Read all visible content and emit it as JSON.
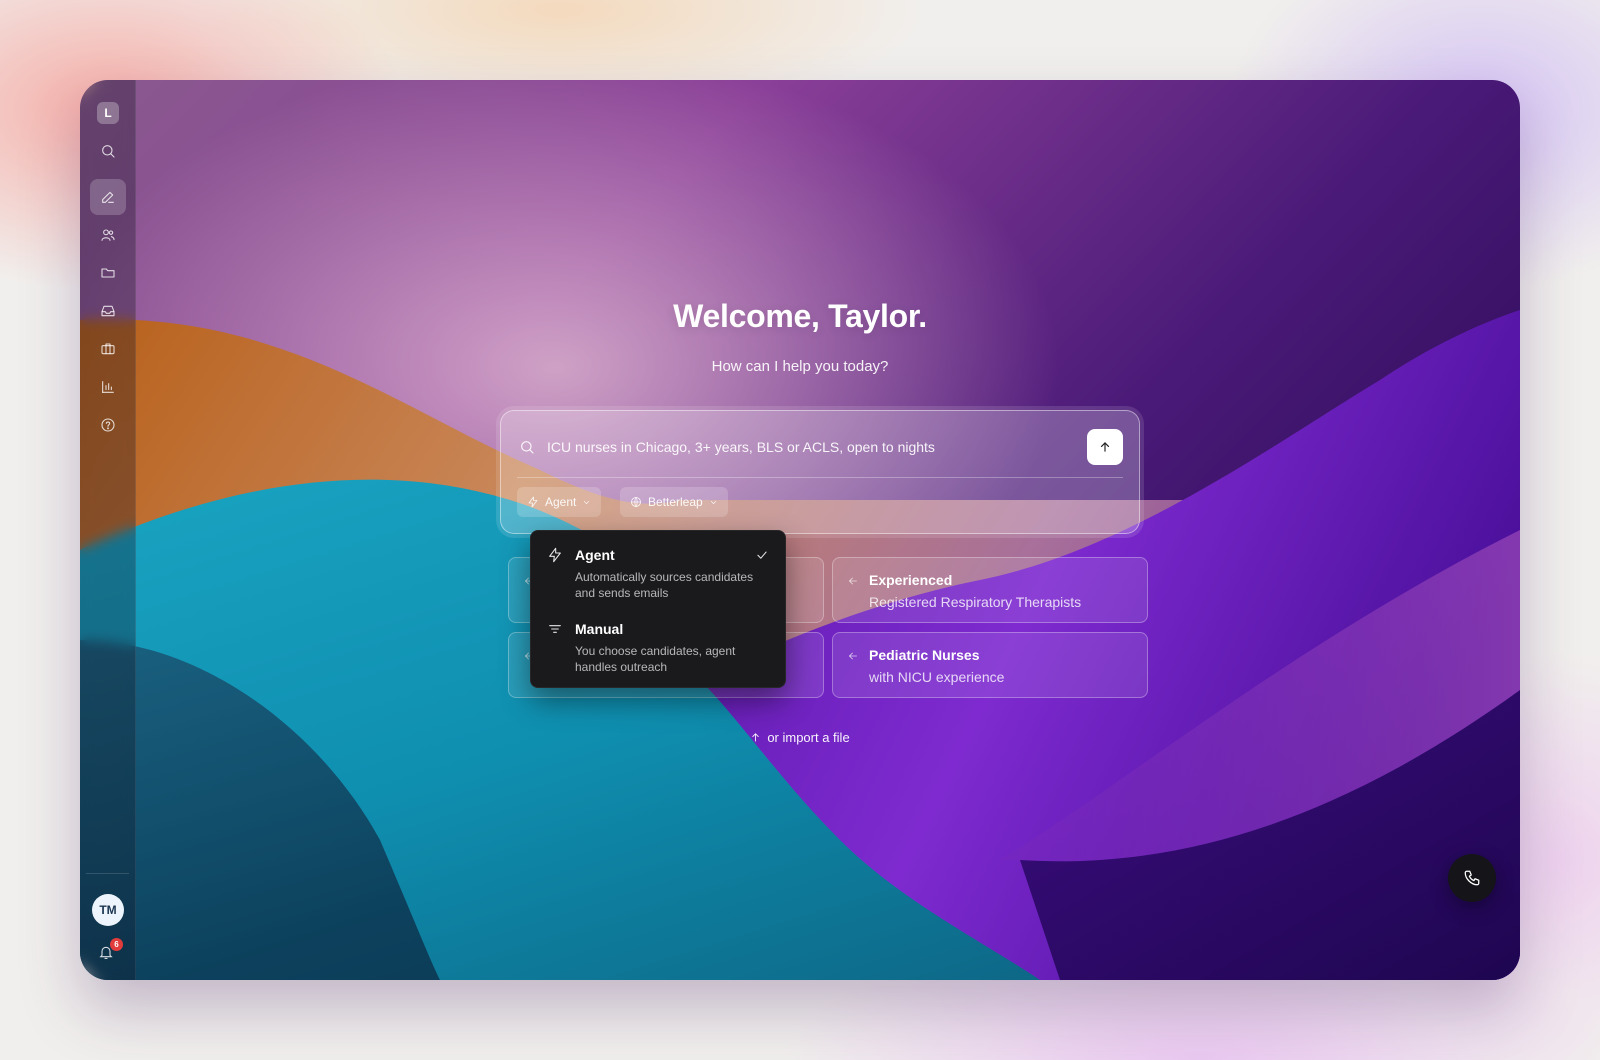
{
  "app": {
    "logo_letter": "L"
  },
  "sidebar": {
    "items": [
      {
        "name": "search",
        "icon": "search-icon"
      },
      {
        "name": "new-chat",
        "icon": "pencil-icon",
        "active": true
      },
      {
        "name": "people",
        "icon": "users-icon"
      },
      {
        "name": "projects",
        "icon": "folder-icon"
      },
      {
        "name": "inbox",
        "icon": "inbox-icon"
      },
      {
        "name": "jobs",
        "icon": "briefcase-icon"
      },
      {
        "name": "analytics",
        "icon": "bar-chart-icon"
      },
      {
        "name": "help",
        "icon": "help-circle-icon"
      }
    ],
    "user_initials": "TM",
    "notification_count": "6"
  },
  "main": {
    "welcome": "Welcome, Taylor.",
    "subtitle": "How can I help you today?",
    "prompt": {
      "placeholder": "ICU nurses in Chicago, 3+ years, BLS or ACLS, open to nights",
      "mode_chip": "Agent",
      "source_chip": "Betterleap"
    },
    "suggestions": [
      {
        "title": "",
        "subtitle": ""
      },
      {
        "title": "Experienced",
        "subtitle": "Registered Respiratory Therapists"
      },
      {
        "title": "",
        "subtitle": ""
      },
      {
        "title": "Pediatric Nurses",
        "subtitle": "with NICU experience"
      }
    ],
    "import_label": "or import a file"
  },
  "mode_dropdown": {
    "options": [
      {
        "label": "Agent",
        "description": "Automatically sources candidates and sends emails",
        "selected": true,
        "icon": "lightning-icon"
      },
      {
        "label": "Manual",
        "description": "You choose candidates, agent handles outreach",
        "selected": false,
        "icon": "filter-icon"
      }
    ]
  },
  "colors": {
    "dropdown_bg": "#1a1a1d",
    "call_button": "#141419",
    "badge": "#e23b3b"
  }
}
